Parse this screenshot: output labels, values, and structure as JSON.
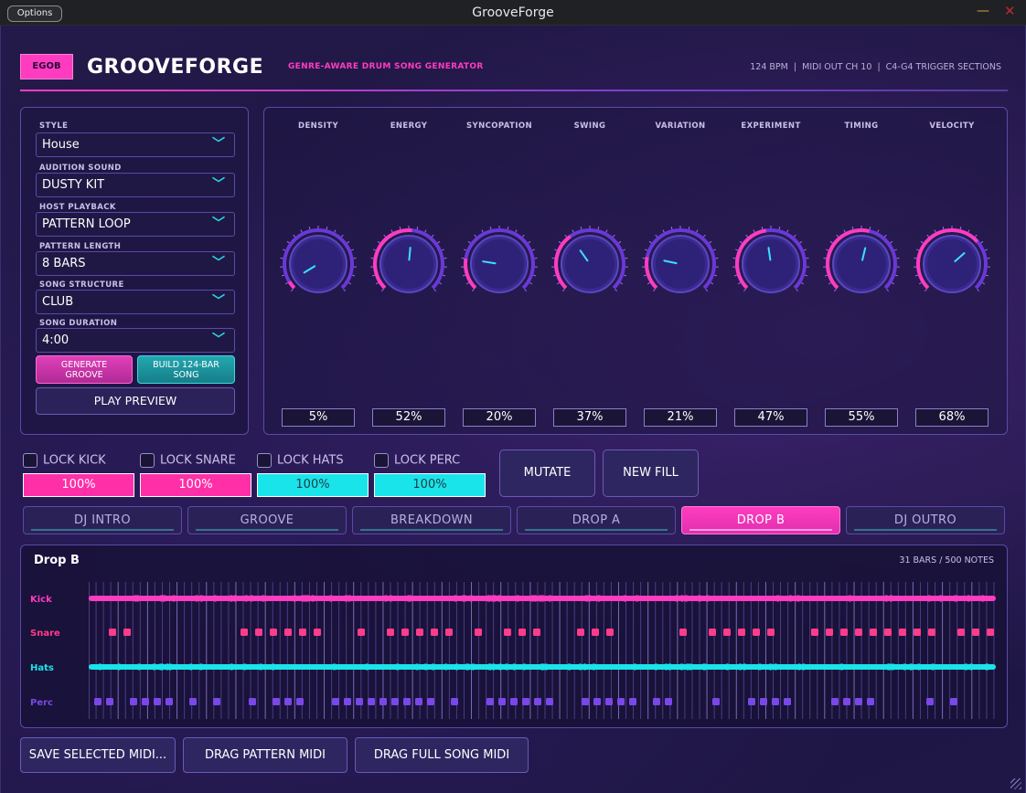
{
  "window": {
    "title": "GrooveForge",
    "options_label": "Options",
    "minimize_glyph": "—",
    "close_glyph": "✕"
  },
  "header": {
    "badge": "EGOB",
    "brand": "GROOVEFORGE",
    "tagline": "GENRE-AWARE DRUM SONG GENERATOR",
    "info": "124 BPM  |  MIDI OUT CH 10  |  C4-G4 TRIGGER SECTIONS",
    "accent_pink": "#ff3cc0",
    "accent_cyan": "#19e4ea"
  },
  "settings": {
    "style": {
      "label": "STYLE",
      "value": "House"
    },
    "audition": {
      "label": "AUDITION SOUND",
      "value": "DUSTY KIT"
    },
    "host": {
      "label": "HOST PLAYBACK",
      "value": "PATTERN LOOP"
    },
    "length": {
      "label": "PATTERN LENGTH",
      "value": "8 BARS"
    },
    "structure": {
      "label": "SONG STRUCTURE",
      "value": "CLUB"
    },
    "duration": {
      "label": "SONG DURATION",
      "value": "4:00"
    },
    "chevron": "﹀",
    "generate_label_1": "GENERATE",
    "generate_label_2": "GROOVE",
    "build_label_1": "BUILD 124-BAR",
    "build_label_2": "SONG",
    "play_label": "PLAY PREVIEW"
  },
  "knobs": [
    {
      "label": "DENSITY",
      "value": "5%",
      "level": 0.05
    },
    {
      "label": "ENERGY",
      "value": "52%",
      "level": 0.52
    },
    {
      "label": "SYNCOPATION",
      "value": "20%",
      "level": 0.2
    },
    {
      "label": "SWING",
      "value": "37%",
      "level": 0.37
    },
    {
      "label": "VARIATION",
      "value": "21%",
      "level": 0.21
    },
    {
      "label": "EXPERIMENT",
      "value": "47%",
      "level": 0.47
    },
    {
      "label": "TIMING",
      "value": "55%",
      "level": 0.55
    },
    {
      "label": "VELOCITY",
      "value": "68%",
      "level": 0.68
    }
  ],
  "locks": [
    {
      "label": "LOCK KICK",
      "level_text": "100%",
      "level": 1.0
    },
    {
      "label": "LOCK SNARE",
      "level_text": "100%",
      "level": 1.0
    },
    {
      "label": "LOCK HATS",
      "level_text": "100%",
      "level": 1.0
    },
    {
      "label": "LOCK PERC",
      "level_text": "100%",
      "level": 1.0
    }
  ],
  "actions": {
    "mutate": "MUTATE",
    "new_fill": "NEW FILL"
  },
  "sections": [
    {
      "label": "DJ INTRO",
      "active": false
    },
    {
      "label": "GROOVE",
      "active": false
    },
    {
      "label": "BREAKDOWN",
      "active": false
    },
    {
      "label": "DROP A",
      "active": false
    },
    {
      "label": "DROP B",
      "active": true
    },
    {
      "label": "DJ OUTRO",
      "active": false
    }
  ],
  "pattern": {
    "title": "Drop B",
    "info": "31 BARS  /  500 NOTES",
    "rows": [
      {
        "label": "Kick",
        "color": "#ff3cc0"
      },
      {
        "label": "Snare",
        "color": "#ff3c8c"
      },
      {
        "label": "Hats",
        "color": "#19e4ea"
      },
      {
        "label": "Perc",
        "color": "#7a48e8"
      }
    ]
  },
  "bottom": {
    "save": "SAVE SELECTED MIDI...",
    "drag_pattern": "DRAG PATTERN MIDI",
    "drag_song": "DRAG FULL SONG MIDI"
  }
}
